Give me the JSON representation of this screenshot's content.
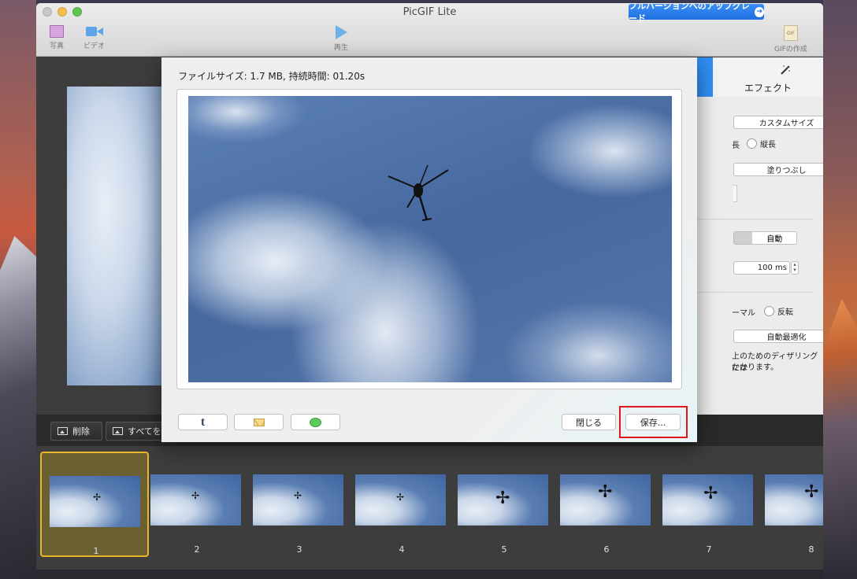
{
  "window": {
    "title": "PicGIF Lite",
    "upgrade_label": "フルバージョンへのアップグレード"
  },
  "toolbar": {
    "photo_label": "写真",
    "video_label": "ビデオ",
    "play_label": "再生",
    "gif_icon_text": "GIF",
    "create_gif_label": "GIFの作成"
  },
  "inspector": {
    "effect_tab_label": "エフェクト",
    "size_popup": "カスタムサイズ",
    "orientation_landscape": "長",
    "orientation_portrait": "縦長",
    "fill_popup": "塗りつぶし",
    "timing_auto": "自動",
    "delay_value": "100 ms",
    "play_normal": "ーマル",
    "play_reverse": "反転",
    "optimize_popup": "自動最適化",
    "dither_line1": "上のためのディザリングには",
    "dither_line2": "かかります。"
  },
  "bottom_bar": {
    "delete_label": "削除",
    "select_all_label": "すべてを"
  },
  "filmstrip": {
    "frames": [
      "1",
      "2",
      "3",
      "4",
      "5",
      "6",
      "7",
      "8"
    ],
    "selected": "1"
  },
  "sheet": {
    "file_info": "ファイルサイズ: 1.7 MB,  持続時間: 01.20s",
    "tumblr_icon": "t",
    "close_label": "閉じる",
    "save_label": "保存..."
  },
  "colors": {
    "accent": "#2f8ef3",
    "selection": "#e8b728",
    "highlight": "#e0161a"
  }
}
